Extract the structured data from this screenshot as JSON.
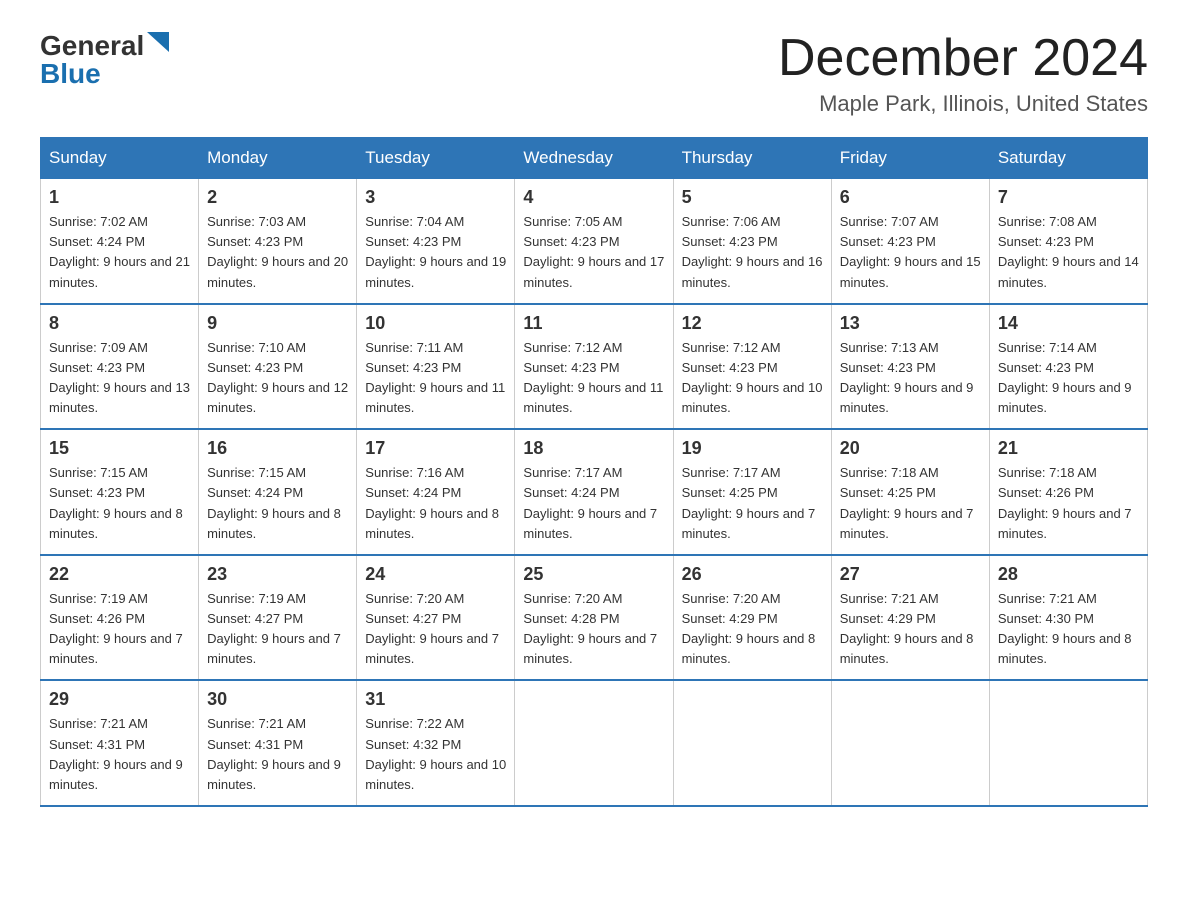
{
  "header": {
    "logo_general": "General",
    "logo_blue": "Blue",
    "month": "December 2024",
    "location": "Maple Park, Illinois, United States"
  },
  "days_of_week": [
    "Sunday",
    "Monday",
    "Tuesday",
    "Wednesday",
    "Thursday",
    "Friday",
    "Saturday"
  ],
  "weeks": [
    [
      {
        "day": "1",
        "sunrise": "7:02 AM",
        "sunset": "4:24 PM",
        "daylight": "9 hours and 21 minutes."
      },
      {
        "day": "2",
        "sunrise": "7:03 AM",
        "sunset": "4:23 PM",
        "daylight": "9 hours and 20 minutes."
      },
      {
        "day": "3",
        "sunrise": "7:04 AM",
        "sunset": "4:23 PM",
        "daylight": "9 hours and 19 minutes."
      },
      {
        "day": "4",
        "sunrise": "7:05 AM",
        "sunset": "4:23 PM",
        "daylight": "9 hours and 17 minutes."
      },
      {
        "day": "5",
        "sunrise": "7:06 AM",
        "sunset": "4:23 PM",
        "daylight": "9 hours and 16 minutes."
      },
      {
        "day": "6",
        "sunrise": "7:07 AM",
        "sunset": "4:23 PM",
        "daylight": "9 hours and 15 minutes."
      },
      {
        "day": "7",
        "sunrise": "7:08 AM",
        "sunset": "4:23 PM",
        "daylight": "9 hours and 14 minutes."
      }
    ],
    [
      {
        "day": "8",
        "sunrise": "7:09 AM",
        "sunset": "4:23 PM",
        "daylight": "9 hours and 13 minutes."
      },
      {
        "day": "9",
        "sunrise": "7:10 AM",
        "sunset": "4:23 PM",
        "daylight": "9 hours and 12 minutes."
      },
      {
        "day": "10",
        "sunrise": "7:11 AM",
        "sunset": "4:23 PM",
        "daylight": "9 hours and 11 minutes."
      },
      {
        "day": "11",
        "sunrise": "7:12 AM",
        "sunset": "4:23 PM",
        "daylight": "9 hours and 11 minutes."
      },
      {
        "day": "12",
        "sunrise": "7:12 AM",
        "sunset": "4:23 PM",
        "daylight": "9 hours and 10 minutes."
      },
      {
        "day": "13",
        "sunrise": "7:13 AM",
        "sunset": "4:23 PM",
        "daylight": "9 hours and 9 minutes."
      },
      {
        "day": "14",
        "sunrise": "7:14 AM",
        "sunset": "4:23 PM",
        "daylight": "9 hours and 9 minutes."
      }
    ],
    [
      {
        "day": "15",
        "sunrise": "7:15 AM",
        "sunset": "4:23 PM",
        "daylight": "9 hours and 8 minutes."
      },
      {
        "day": "16",
        "sunrise": "7:15 AM",
        "sunset": "4:24 PM",
        "daylight": "9 hours and 8 minutes."
      },
      {
        "day": "17",
        "sunrise": "7:16 AM",
        "sunset": "4:24 PM",
        "daylight": "9 hours and 8 minutes."
      },
      {
        "day": "18",
        "sunrise": "7:17 AM",
        "sunset": "4:24 PM",
        "daylight": "9 hours and 7 minutes."
      },
      {
        "day": "19",
        "sunrise": "7:17 AM",
        "sunset": "4:25 PM",
        "daylight": "9 hours and 7 minutes."
      },
      {
        "day": "20",
        "sunrise": "7:18 AM",
        "sunset": "4:25 PM",
        "daylight": "9 hours and 7 minutes."
      },
      {
        "day": "21",
        "sunrise": "7:18 AM",
        "sunset": "4:26 PM",
        "daylight": "9 hours and 7 minutes."
      }
    ],
    [
      {
        "day": "22",
        "sunrise": "7:19 AM",
        "sunset": "4:26 PM",
        "daylight": "9 hours and 7 minutes."
      },
      {
        "day": "23",
        "sunrise": "7:19 AM",
        "sunset": "4:27 PM",
        "daylight": "9 hours and 7 minutes."
      },
      {
        "day": "24",
        "sunrise": "7:20 AM",
        "sunset": "4:27 PM",
        "daylight": "9 hours and 7 minutes."
      },
      {
        "day": "25",
        "sunrise": "7:20 AM",
        "sunset": "4:28 PM",
        "daylight": "9 hours and 7 minutes."
      },
      {
        "day": "26",
        "sunrise": "7:20 AM",
        "sunset": "4:29 PM",
        "daylight": "9 hours and 8 minutes."
      },
      {
        "day": "27",
        "sunrise": "7:21 AM",
        "sunset": "4:29 PM",
        "daylight": "9 hours and 8 minutes."
      },
      {
        "day": "28",
        "sunrise": "7:21 AM",
        "sunset": "4:30 PM",
        "daylight": "9 hours and 8 minutes."
      }
    ],
    [
      {
        "day": "29",
        "sunrise": "7:21 AM",
        "sunset": "4:31 PM",
        "daylight": "9 hours and 9 minutes."
      },
      {
        "day": "30",
        "sunrise": "7:21 AM",
        "sunset": "4:31 PM",
        "daylight": "9 hours and 9 minutes."
      },
      {
        "day": "31",
        "sunrise": "7:22 AM",
        "sunset": "4:32 PM",
        "daylight": "9 hours and 10 minutes."
      },
      null,
      null,
      null,
      null
    ]
  ]
}
